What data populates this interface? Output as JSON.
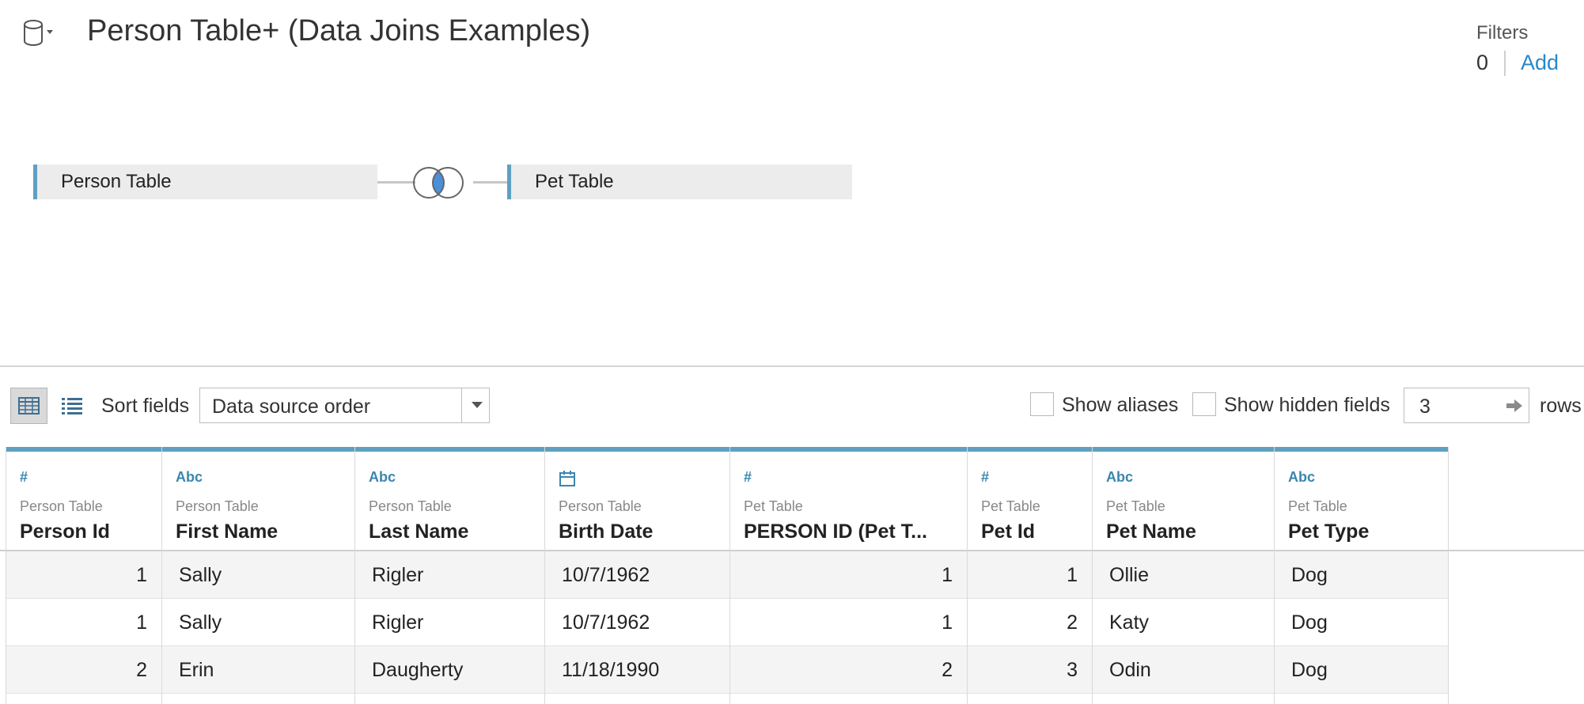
{
  "header": {
    "title": "Person Table+ (Data Joins Examples)",
    "datasource_icon": "database-icon",
    "filters_label": "Filters",
    "filters_count": "0",
    "filters_add": "Add"
  },
  "join": {
    "left_table": "Person Table",
    "right_table": "Pet Table",
    "join_type_icon": "inner-join-venn-icon"
  },
  "toolbar": {
    "sort_label": "Sort fields",
    "sort_value": "Data source order",
    "show_aliases": "Show aliases",
    "show_hidden": "Show hidden fields",
    "rows_value": "3",
    "rows_label": "rows"
  },
  "columns": [
    {
      "type": "#",
      "source": "Person Table",
      "name": "Person Id"
    },
    {
      "type": "Abc",
      "source": "Person Table",
      "name": "First Name"
    },
    {
      "type": "Abc",
      "source": "Person Table",
      "name": "Last Name"
    },
    {
      "type": "date",
      "source": "Person Table",
      "name": "Birth Date"
    },
    {
      "type": "#",
      "source": "Pet Table",
      "name": "PERSON ID (Pet T..."
    },
    {
      "type": "#",
      "source": "Pet Table",
      "name": "Pet Id"
    },
    {
      "type": "Abc",
      "source": "Pet Table",
      "name": "Pet Name"
    },
    {
      "type": "Abc",
      "source": "Pet Table",
      "name": "Pet Type"
    }
  ],
  "rows": [
    [
      "1",
      "Sally",
      "Rigler",
      "10/7/1962",
      "1",
      "1",
      "Ollie",
      "Dog"
    ],
    [
      "1",
      "Sally",
      "Rigler",
      "10/7/1962",
      "1",
      "2",
      "Katy",
      "Dog"
    ],
    [
      "2",
      "Erin",
      "Daugherty",
      "11/18/1990",
      "2",
      "3",
      "Odin",
      "Dog"
    ]
  ],
  "colors": {
    "accent": "#5fa0c2",
    "link": "#2a87c8",
    "join_fill": "#4a90d9"
  }
}
